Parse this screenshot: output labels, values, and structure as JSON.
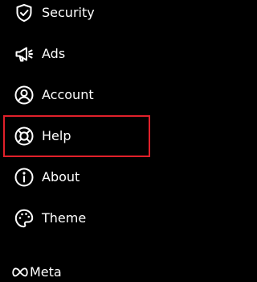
{
  "menu": {
    "items": [
      {
        "label": "Security",
        "icon": "shield-check-icon"
      },
      {
        "label": "Ads",
        "icon": "megaphone-icon"
      },
      {
        "label": "Account",
        "icon": "account-circle-icon"
      },
      {
        "label": "Help",
        "icon": "lifebuoy-icon"
      },
      {
        "label": "About",
        "icon": "info-icon"
      },
      {
        "label": "Theme",
        "icon": "palette-icon"
      }
    ]
  },
  "footer": {
    "brand": "Meta",
    "logo_icon": "meta-infinity-icon"
  },
  "colors": {
    "background": "#000000",
    "text": "#ffffff",
    "highlight": "#e0202a"
  }
}
